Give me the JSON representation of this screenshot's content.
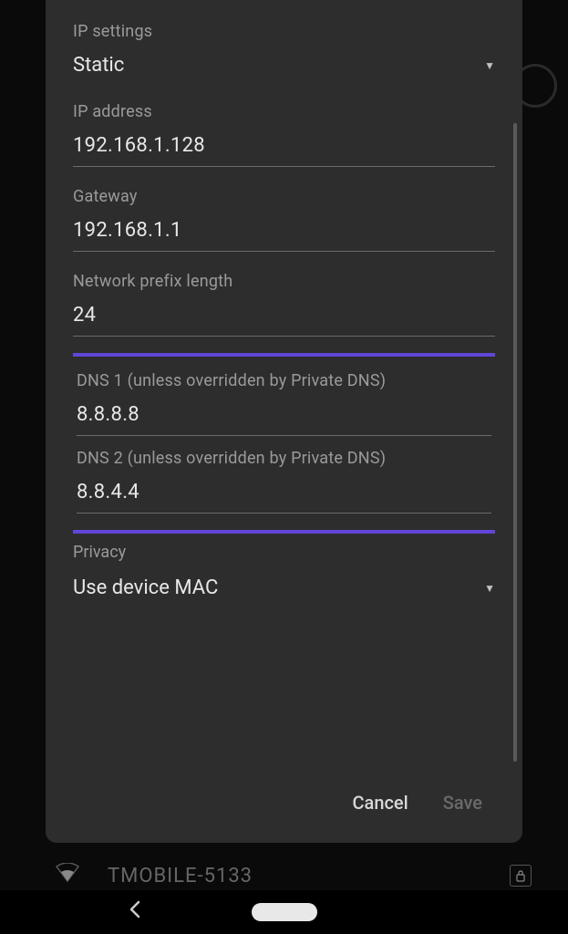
{
  "background": {
    "wifi_name": "TMOBILE-5133"
  },
  "dialog": {
    "fields": {
      "ip_settings_label": "IP settings",
      "ip_settings_value": "Static",
      "ip_address_label": "IP address",
      "ip_address_value": "192.168.1.128",
      "gateway_label": "Gateway",
      "gateway_value": "192.168.1.1",
      "prefix_label": "Network prefix length",
      "prefix_value": "24",
      "dns1_label": "DNS 1 (unless overridden by Private DNS)",
      "dns1_value": "8.8.8.8",
      "dns2_label": "DNS 2 (unless overridden by Private DNS)",
      "dns2_value": "8.8.4.4",
      "privacy_label": "Privacy",
      "privacy_value": "Use device MAC"
    },
    "actions": {
      "cancel": "Cancel",
      "save": "Save"
    }
  }
}
